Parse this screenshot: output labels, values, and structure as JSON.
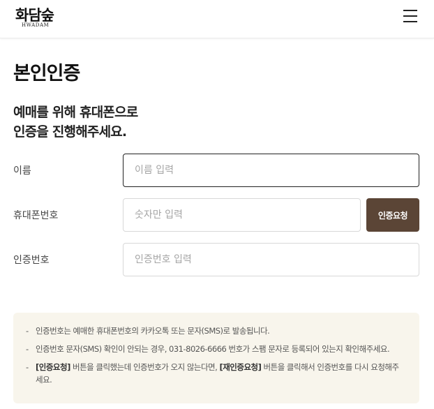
{
  "header": {
    "logo_korean": "화담숲",
    "logo_english": "HWADAM"
  },
  "page": {
    "title": "본인인증",
    "subtitle_line1": "예매를 위해 휴대폰으로",
    "subtitle_line2": "인증을 진행해주세요."
  },
  "form": {
    "name": {
      "label": "이름",
      "placeholder": "이름 입력",
      "value": ""
    },
    "phone": {
      "label": "휴대폰번호",
      "placeholder": "숫자만 입력",
      "value": ""
    },
    "verify_button": "인증요청",
    "code": {
      "label": "인증번호",
      "placeholder": "인증번호 입력",
      "value": ""
    }
  },
  "notice": {
    "bullet": "-",
    "item1": "인증번호는 예매한 휴대폰번호의 카카오톡 또는 문자(SMS)로 발송됩니다.",
    "item2": "인증번호 문자(SMS) 확인이 안되는 경우, 031-8026-6666 번호가 스팸 문자로 등록되어 있는지 확인해주세요.",
    "item3_bold1": "[인증요청]",
    "item3_text1": " 버튼을 클릭했는데 인증번호가 오지 않는다면, ",
    "item3_bold2": "[재인증요청]",
    "item3_text2": " 버튼을 클릭해서 인증번호를 다시 요청해주세요."
  },
  "colors": {
    "accent_brown": "#5b4536",
    "notice_background": "#f8f5ec",
    "focused_border": "#222222"
  },
  "icons": {
    "menu": "hamburger-menu-icon"
  }
}
